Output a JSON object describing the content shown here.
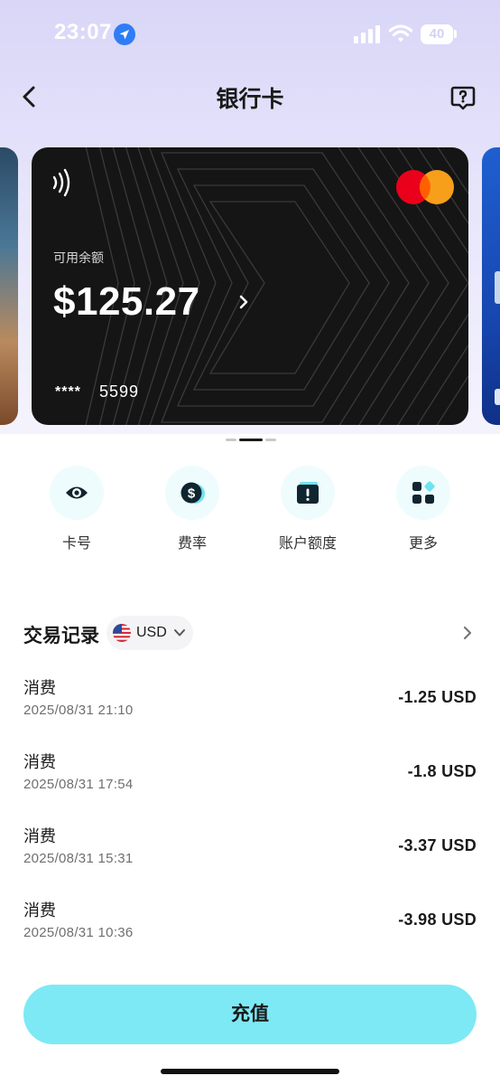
{
  "status_bar": {
    "time": "23:07",
    "battery": "40"
  },
  "nav": {
    "title": "银行卡",
    "back_icon": "chevron-left-icon",
    "help_icon": "question-bubble-icon"
  },
  "card": {
    "balance_label": "可用余额",
    "balance": "$125.27",
    "mask": "****",
    "last4": "5599",
    "network": "mastercard",
    "colors": {
      "background": "#151515",
      "mc_red": "#eb001b",
      "mc_orange": "#f79e1b"
    }
  },
  "carousel": {
    "total": 3,
    "active": 2
  },
  "actions": [
    {
      "label": "卡号",
      "icon": "eye-icon"
    },
    {
      "label": "费率",
      "icon": "dollar-coin-icon"
    },
    {
      "label": "账户额度",
      "icon": "alert-card-icon"
    },
    {
      "label": "更多",
      "icon": "grid-icon"
    }
  ],
  "transactions": {
    "title": "交易记录",
    "currency": "USD",
    "items": [
      {
        "type": "消费",
        "time": "2025/08/31 21:10",
        "amount": "-1.25 USD"
      },
      {
        "type": "消费",
        "time": "2025/08/31 17:54",
        "amount": "-1.8 USD"
      },
      {
        "type": "消费",
        "time": "2025/08/31 15:31",
        "amount": "-3.37 USD"
      },
      {
        "type": "消费",
        "time": "2025/08/31 10:36",
        "amount": "-3.98 USD"
      }
    ]
  },
  "topup": {
    "label": "充值"
  },
  "colors": {
    "accent": "#7de9f5",
    "header_bg": "#d9d6f7",
    "action_bg": "#eefcfd",
    "icon_dark": "#0f2530"
  }
}
